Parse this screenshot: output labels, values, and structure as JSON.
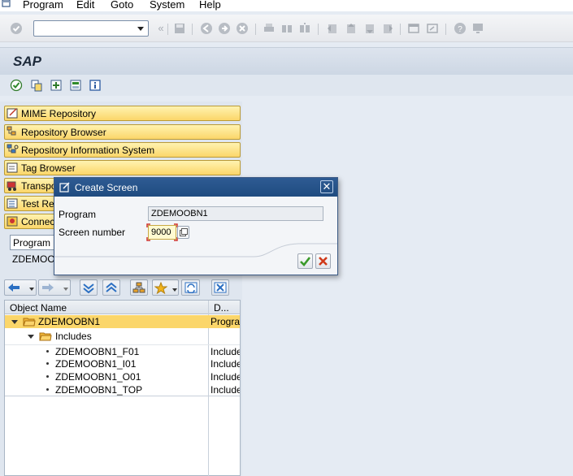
{
  "menu": {
    "items": [
      "Program",
      "Edit",
      "Goto",
      "System",
      "Help"
    ]
  },
  "toolbar": {
    "command_field_value": "",
    "icons": [
      "enter-icon",
      "save-icon",
      "back-icon",
      "exit-icon",
      "cancel-icon",
      "print-icon",
      "find-icon",
      "find-next-icon",
      "first-page-icon",
      "previous-page-icon",
      "next-page-icon",
      "last-page-icon",
      "create-session-icon",
      "shortcut-icon",
      "help-icon",
      "customize-layout-icon"
    ]
  },
  "title": {
    "text": "SAP"
  },
  "app_toolbar": {
    "icons": [
      "check-icon",
      "copy-objects-icon",
      "new-object-icon",
      "activate-icon",
      "info-icon"
    ]
  },
  "navigation": {
    "buttons": [
      {
        "label": "MIME Repository"
      },
      {
        "label": "Repository Browser"
      },
      {
        "label": "Repository Information System"
      },
      {
        "label": "Tag Browser"
      },
      {
        "label": "Transpo"
      },
      {
        "label": "Test Re"
      },
      {
        "label": "Connec"
      }
    ],
    "object_type_selector": "Program",
    "object_name": "ZDEMOOB"
  },
  "tree": {
    "columns": [
      "Object Name",
      "D..."
    ],
    "rows": [
      {
        "name": "ZDEMOOBN1",
        "desc": "Program"
      },
      {
        "name": "Includes",
        "desc": ""
      },
      {
        "name": "ZDEMOOBN1_F01",
        "desc": "Include"
      },
      {
        "name": "ZDEMOOBN1_I01",
        "desc": "Include"
      },
      {
        "name": "ZDEMOOBN1_O01",
        "desc": "Include"
      },
      {
        "name": "ZDEMOOBN1_TOP",
        "desc": "Include"
      }
    ]
  },
  "dialog": {
    "title": "Create Screen",
    "program_label": "Program",
    "program_value": "ZDEMOOBN1",
    "screen_number_label": "Screen number",
    "screen_number_value": "9000"
  },
  "colors": {
    "dialog_title_bg": "#2e5b93",
    "nav_button_bg": "#fbd66a",
    "selected_row_bg": "#fbd66a",
    "ok_green": "#3a9a2a",
    "cancel_red": "#d03a1a"
  }
}
